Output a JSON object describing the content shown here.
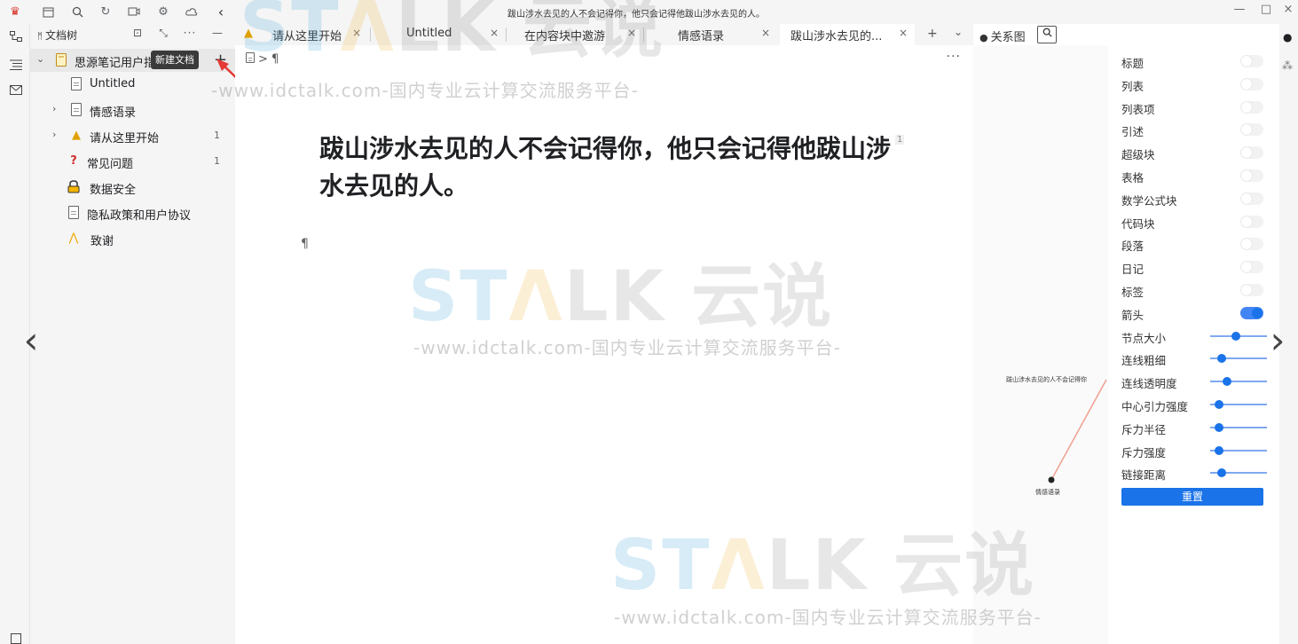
{
  "window": {
    "title": "跋山涉水去见的人不会记得你，他只会记得他跋山涉水去见的人。",
    "minimize": "—",
    "maximize": "□",
    "close": "×"
  },
  "toolbar": {
    "icons": [
      "siyuan-logo-icon",
      "calendar-icon",
      "search-icon",
      "history-icon",
      "record-icon",
      "settings-icon",
      "cloud-icon",
      "collapse-icon"
    ]
  },
  "tree": {
    "title": "文档树",
    "notebook": "思源笔记用户指南",
    "tooltip": "新建文档",
    "add": "+",
    "items": [
      {
        "label": "Untitled",
        "count": ""
      },
      {
        "label": "情感语录",
        "count": ""
      },
      {
        "label": "请从这里开始",
        "count": "1"
      },
      {
        "label": "常见问题",
        "count": "1"
      },
      {
        "label": "数据安全",
        "count": ""
      },
      {
        "label": "隐私政策和用户协议",
        "count": ""
      },
      {
        "label": "致谢",
        "count": ""
      }
    ]
  },
  "tabs": [
    {
      "label": "请从这里开始",
      "close": "×"
    },
    {
      "label": "Untitled",
      "close": "×"
    },
    {
      "label": "在内容块中邀游",
      "close": "×"
    },
    {
      "label": "情感语录",
      "close": "×"
    },
    {
      "label": "跋山涉水去见的...",
      "close": "×"
    }
  ],
  "tab_add": "+",
  "tab_more": "⌄",
  "editor": {
    "breadcrumb": "> ¶",
    "more": "···",
    "title": "跋山涉水去见的人不会记得你，他只会记得他跋山涉水去见的人。",
    "ref_count": "1",
    "pilcrow": "¶"
  },
  "graph": {
    "title": "关系图",
    "search": "🔍",
    "node_main": "跋山涉水去见的人不会记得你",
    "node_child": "情感语录",
    "settings": [
      {
        "label": "标题",
        "type": "toggle",
        "on": false
      },
      {
        "label": "列表",
        "type": "toggle",
        "on": false
      },
      {
        "label": "列表项",
        "type": "toggle",
        "on": false
      },
      {
        "label": "引述",
        "type": "toggle",
        "on": false
      },
      {
        "label": "超级块",
        "type": "toggle",
        "on": false
      },
      {
        "label": "表格",
        "type": "toggle",
        "on": false
      },
      {
        "label": "数学公式块",
        "type": "toggle",
        "on": false
      },
      {
        "label": "代码块",
        "type": "toggle",
        "on": false
      },
      {
        "label": "段落",
        "type": "toggle",
        "on": false
      },
      {
        "label": "日记",
        "type": "toggle",
        "on": false
      },
      {
        "label": "标签",
        "type": "toggle",
        "on": false
      },
      {
        "label": "箭头",
        "type": "toggle",
        "on": true
      },
      {
        "label": "节点大小",
        "type": "slider",
        "value": 0.45
      },
      {
        "label": "连线粗细",
        "type": "slider",
        "value": 0.2
      },
      {
        "label": "连线透明度",
        "type": "slider",
        "value": 0.3
      },
      {
        "label": "中心引力强度",
        "type": "slider",
        "value": 0.15
      },
      {
        "label": "斥力半径",
        "type": "slider",
        "value": 0.15
      },
      {
        "label": "斥力强度",
        "type": "slider",
        "value": 0.15
      },
      {
        "label": "链接距离",
        "type": "slider",
        "value": 0.2
      }
    ],
    "reset": "重置"
  },
  "watermark": {
    "logo_left": "S",
    "logo_t": "T",
    "logo_a": "Λ",
    "logo_rest": "LK 云说",
    "text": "-www.idctalk.com-国内专业云计算交流服务平台-"
  },
  "nav": {
    "prev": "‹",
    "next": "›"
  },
  "colors": {
    "accent": "#1a73e8",
    "arrow": "#e53935"
  }
}
